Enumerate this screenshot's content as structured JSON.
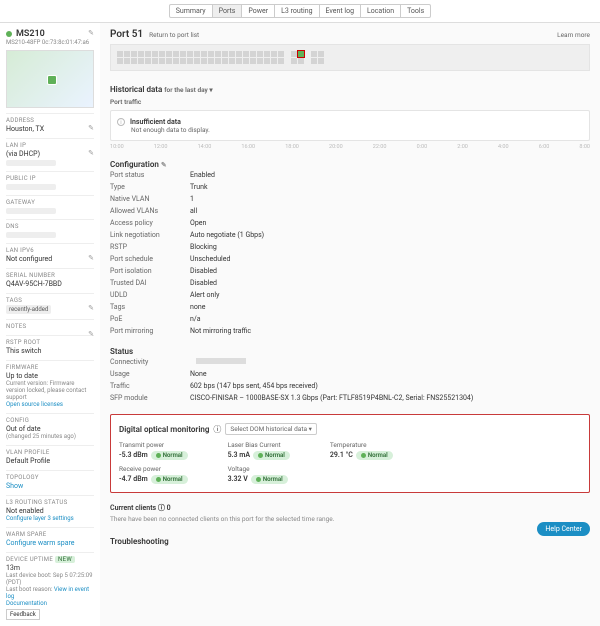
{
  "tabs": {
    "items": [
      "Summary",
      "Ports",
      "Power",
      "L3 routing",
      "Event log",
      "Location",
      "Tools"
    ],
    "active": "Ports"
  },
  "device": {
    "name": "MS210",
    "model": "MS210-48FP",
    "mac": "0c:73:8c:01:47:a6"
  },
  "sidebar": {
    "address_lbl": "ADDRESS",
    "address": "Houston, TX",
    "lanip_lbl": "LAN IP",
    "lanip_via": "(via DHCP)",
    "publicip_lbl": "PUBLIC IP",
    "gateway_lbl": "GATEWAY",
    "dns_lbl": "DNS",
    "lanipv6_lbl": "LAN IPV6",
    "lanipv6": "Not configured",
    "serial_lbl": "SERIAL NUMBER",
    "serial": "Q4AV-95CH-7BBD",
    "tags_lbl": "TAGS",
    "tag": "recently-added",
    "notes_lbl": "NOTES",
    "rstproot_lbl": "RSTP ROOT",
    "rstproot": "This switch",
    "fw_lbl": "FIRMWARE",
    "fw1": "Up to date",
    "fw2": "Current version: Firmware version locked, please contact support",
    "fw3": "Open source licenses",
    "cfg_lbl": "CONFIG",
    "cfg1": "Out of date",
    "cfg2": "(changed 25 minutes ago)",
    "vlan_lbl": "VLAN PROFILE",
    "vlan": "Default Profile",
    "topo_lbl": "TOPOLOGY",
    "topo": "Show",
    "l3_lbl": "L3 ROUTING STATUS",
    "l3a": "Not enabled",
    "l3b": "Configure layer 3 settings",
    "warm_lbl": "WARM SPARE",
    "warm": "Configure warm spare",
    "uptime_lbl": "DEVICE UPTIME",
    "uptime_badge": "NEW",
    "uptime_val": "13m",
    "boot1": "Last device boot: Sep 5 07:25:09 (PDT)",
    "boot2": "Last boot reason: ",
    "boot2link": "View in event log",
    "doc": "Documentation",
    "fb": "Feedback"
  },
  "port": {
    "title": "Port 51",
    "return": "Return to port list",
    "learn": "Learn more"
  },
  "hist": {
    "title": "Historical data",
    "range": "for the last day ▾",
    "traffic": "Port traffic",
    "insuff": "Insufficient data",
    "insuff_sub": "Not enough data to display.",
    "ticks": [
      "10:00",
      "12:00",
      "14:00",
      "16:00",
      "18:00",
      "20:00",
      "22:00",
      "0:00",
      "2:00",
      "4:00",
      "6:00",
      "8:00"
    ]
  },
  "conf": {
    "title": "Configuration",
    "rows": [
      {
        "l": "Port status",
        "v": "Enabled"
      },
      {
        "l": "Type",
        "v": "Trunk"
      },
      {
        "l": "Native VLAN",
        "v": "1"
      },
      {
        "l": "Allowed VLANs",
        "v": "all"
      },
      {
        "l": "Access policy",
        "v": "Open"
      },
      {
        "l": "Link negotiation",
        "v": "Auto negotiate (1 Gbps)"
      },
      {
        "l": "RSTP",
        "v": "Blocking"
      },
      {
        "l": "Port schedule",
        "v": "Unscheduled"
      },
      {
        "l": "Port isolation",
        "v": "Disabled"
      },
      {
        "l": "Trusted DAI",
        "v": "Disabled"
      },
      {
        "l": "UDLD",
        "v": "Alert only"
      },
      {
        "l": "Tags",
        "v": "none"
      },
      {
        "l": "PoE",
        "v": "n/a"
      },
      {
        "l": "Port mirroring",
        "v": "Not mirroring traffic"
      }
    ]
  },
  "status": {
    "title": "Status",
    "conn": "Connectivity",
    "usage_l": "Usage",
    "usage": "None",
    "traffic_l": "Traffic",
    "traffic": "602 bps (147 bps sent, 454 bps received)",
    "sfp_l": "SFP module",
    "sfp": "CISCO-FINISAR – 1000BASE-SX 1.3 Gbps (Part: FTLF8519P4BNL-C2, Serial: FNS25521304)"
  },
  "dom": {
    "title": "Digital optical monitoring",
    "info": "ⓘ",
    "select": "Select DOM historical data ▾",
    "tx_l": "Transmit power",
    "tx": "-5.3 dBm",
    "rx_l": "Receive power",
    "rx": "-4.7 dBm",
    "bias_l": "Laser Bias Current",
    "bias": "5.3 mA",
    "volt_l": "Voltage",
    "volt": "3.32 V",
    "temp_l": "Temperature",
    "temp": "29.1 °C",
    "normal": "Normal"
  },
  "clients": {
    "title": "Current clients",
    "count": "0",
    "note": "There have been no connected clients on this port for the selected time range."
  },
  "trouble": "Troubleshooting",
  "help": "Help Center"
}
